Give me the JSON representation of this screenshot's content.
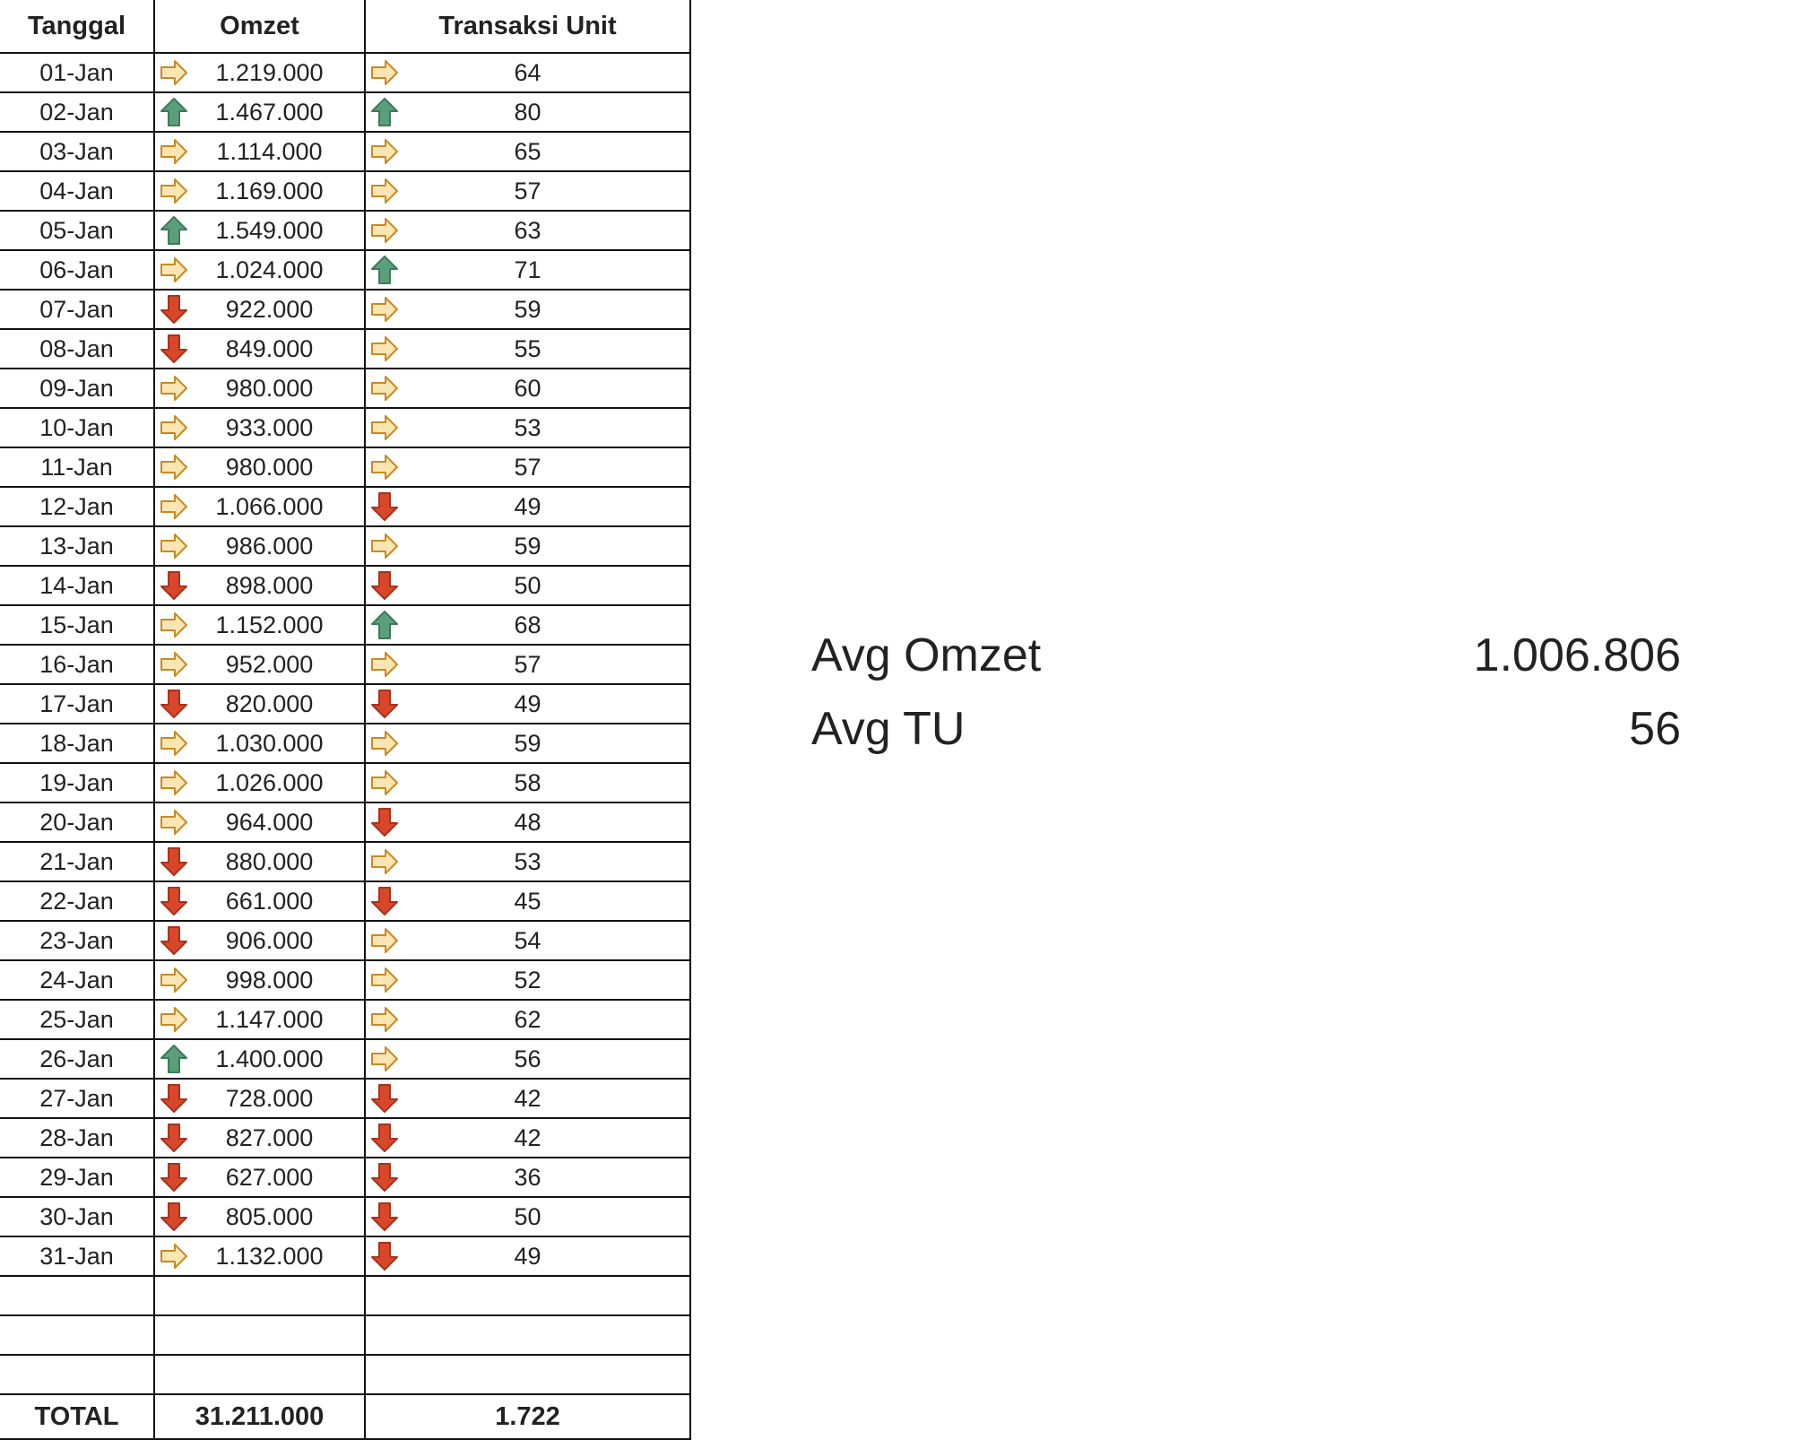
{
  "table": {
    "headers": {
      "date": "Tanggal",
      "omzet": "Omzet",
      "units": "Transaksi Unit"
    },
    "rows": [
      {
        "date": "01-Jan",
        "omzet": "1.219.000",
        "omzet_trend": "right",
        "units": "64",
        "units_trend": "right"
      },
      {
        "date": "02-Jan",
        "omzet": "1.467.000",
        "omzet_trend": "up",
        "units": "80",
        "units_trend": "up"
      },
      {
        "date": "03-Jan",
        "omzet": "1.114.000",
        "omzet_trend": "right",
        "units": "65",
        "units_trend": "right"
      },
      {
        "date": "04-Jan",
        "omzet": "1.169.000",
        "omzet_trend": "right",
        "units": "57",
        "units_trend": "right"
      },
      {
        "date": "05-Jan",
        "omzet": "1.549.000",
        "omzet_trend": "up",
        "units": "63",
        "units_trend": "right"
      },
      {
        "date": "06-Jan",
        "omzet": "1.024.000",
        "omzet_trend": "right",
        "units": "71",
        "units_trend": "up"
      },
      {
        "date": "07-Jan",
        "omzet": "922.000",
        "omzet_trend": "down",
        "units": "59",
        "units_trend": "right"
      },
      {
        "date": "08-Jan",
        "omzet": "849.000",
        "omzet_trend": "down",
        "units": "55",
        "units_trend": "right"
      },
      {
        "date": "09-Jan",
        "omzet": "980.000",
        "omzet_trend": "right",
        "units": "60",
        "units_trend": "right"
      },
      {
        "date": "10-Jan",
        "omzet": "933.000",
        "omzet_trend": "right",
        "units": "53",
        "units_trend": "right"
      },
      {
        "date": "11-Jan",
        "omzet": "980.000",
        "omzet_trend": "right",
        "units": "57",
        "units_trend": "right"
      },
      {
        "date": "12-Jan",
        "omzet": "1.066.000",
        "omzet_trend": "right",
        "units": "49",
        "units_trend": "down"
      },
      {
        "date": "13-Jan",
        "omzet": "986.000",
        "omzet_trend": "right",
        "units": "59",
        "units_trend": "right"
      },
      {
        "date": "14-Jan",
        "omzet": "898.000",
        "omzet_trend": "down",
        "units": "50",
        "units_trend": "down"
      },
      {
        "date": "15-Jan",
        "omzet": "1.152.000",
        "omzet_trend": "right",
        "units": "68",
        "units_trend": "up"
      },
      {
        "date": "16-Jan",
        "omzet": "952.000",
        "omzet_trend": "right",
        "units": "57",
        "units_trend": "right"
      },
      {
        "date": "17-Jan",
        "omzet": "820.000",
        "omzet_trend": "down",
        "units": "49",
        "units_trend": "down"
      },
      {
        "date": "18-Jan",
        "omzet": "1.030.000",
        "omzet_trend": "right",
        "units": "59",
        "units_trend": "right"
      },
      {
        "date": "19-Jan",
        "omzet": "1.026.000",
        "omzet_trend": "right",
        "units": "58",
        "units_trend": "right"
      },
      {
        "date": "20-Jan",
        "omzet": "964.000",
        "omzet_trend": "right",
        "units": "48",
        "units_trend": "down"
      },
      {
        "date": "21-Jan",
        "omzet": "880.000",
        "omzet_trend": "down",
        "units": "53",
        "units_trend": "right"
      },
      {
        "date": "22-Jan",
        "omzet": "661.000",
        "omzet_trend": "down",
        "units": "45",
        "units_trend": "down"
      },
      {
        "date": "23-Jan",
        "omzet": "906.000",
        "omzet_trend": "down",
        "units": "54",
        "units_trend": "right"
      },
      {
        "date": "24-Jan",
        "omzet": "998.000",
        "omzet_trend": "right",
        "units": "52",
        "units_trend": "right"
      },
      {
        "date": "25-Jan",
        "omzet": "1.147.000",
        "omzet_trend": "right",
        "units": "62",
        "units_trend": "right"
      },
      {
        "date": "26-Jan",
        "omzet": "1.400.000",
        "omzet_trend": "up",
        "units": "56",
        "units_trend": "right"
      },
      {
        "date": "27-Jan",
        "omzet": "728.000",
        "omzet_trend": "down",
        "units": "42",
        "units_trend": "down"
      },
      {
        "date": "28-Jan",
        "omzet": "827.000",
        "omzet_trend": "down",
        "units": "42",
        "units_trend": "down"
      },
      {
        "date": "29-Jan",
        "omzet": "627.000",
        "omzet_trend": "down",
        "units": "36",
        "units_trend": "down"
      },
      {
        "date": "30-Jan",
        "omzet": "805.000",
        "omzet_trend": "down",
        "units": "50",
        "units_trend": "down"
      },
      {
        "date": "31-Jan",
        "omzet": "1.132.000",
        "omzet_trend": "right",
        "units": "49",
        "units_trend": "down"
      }
    ],
    "blank_rows": 3,
    "total": {
      "label": "TOTAL",
      "omzet": "31.211.000",
      "units": "1.722"
    }
  },
  "summary": {
    "avg_omzet_label": "Avg Omzet",
    "avg_omzet_value": "1.006.806",
    "avg_tu_label": "Avg TU",
    "avg_tu_value": "56"
  },
  "icons": {
    "up": "arrow-up-icon",
    "right": "arrow-right-icon",
    "down": "arrow-down-icon"
  },
  "colors": {
    "up": "#5a9f7a",
    "right": "#e8b24f",
    "down": "#d9472b"
  }
}
